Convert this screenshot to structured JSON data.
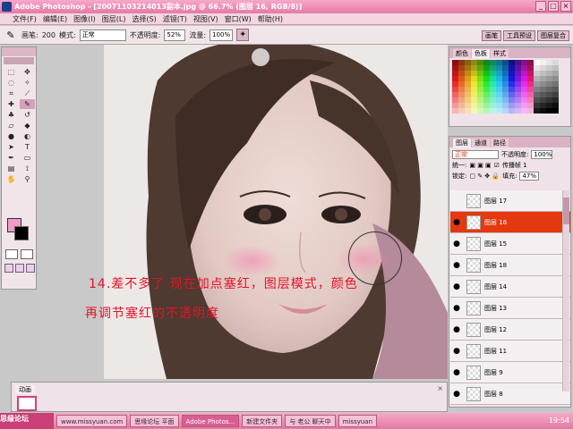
{
  "window": {
    "title": "Adobe Photoshop - [20071103214013副本.jpg @ 66.7% (图层 16, RGB/8)]"
  },
  "menu": [
    "文件(F)",
    "编辑(E)",
    "图像(I)",
    "图层(L)",
    "选择(S)",
    "滤镜(T)",
    "视图(V)",
    "窗口(W)",
    "帮助(H)"
  ],
  "options": {
    "brush_label": "画笔:",
    "brush_size": "200",
    "mode_label": "模式:",
    "mode_value": "正常",
    "opacity_label": "不透明度:",
    "opacity_value": "52%",
    "flow_label": "流量:",
    "flow_value": "100%"
  },
  "palette_well": [
    "画笔",
    "工具预设",
    "图层复合"
  ],
  "overlay": {
    "line1": "14.差不多了 现在加点塞红，图层模式，颜色",
    "line2": "再调节塞红的不透明度"
  },
  "swatches_panel": {
    "tabs": [
      "颜色",
      "色板",
      "样式"
    ],
    "active_tab": "色板"
  },
  "layers_panel": {
    "tabs": [
      "图层",
      "通道",
      "路径"
    ],
    "active_tab": "图层",
    "blend_mode": "正常",
    "opacity_label": "不透明度:",
    "opacity_value": "100%",
    "unify_label": "统一:",
    "propagate_label": "传播帧 1",
    "lock_label": "锁定:",
    "fill_label": "填充:",
    "fill_value": "47%",
    "layers": [
      {
        "name": "图层 17",
        "visible": false,
        "active": false
      },
      {
        "name": "图层 16",
        "visible": true,
        "active": true
      },
      {
        "name": "图层 15",
        "visible": true,
        "active": false
      },
      {
        "name": "图层 18",
        "visible": true,
        "active": false
      },
      {
        "name": "图层 14",
        "visible": true,
        "active": false
      },
      {
        "name": "图层 13",
        "visible": true,
        "active": false
      },
      {
        "name": "图层 12",
        "visible": true,
        "active": false
      },
      {
        "name": "图层 11",
        "visible": true,
        "active": false
      },
      {
        "name": "图层 9",
        "visible": true,
        "active": false
      },
      {
        "name": "图层 8",
        "visible": true,
        "active": false
      }
    ]
  },
  "animation_panel": {
    "tab": "动画"
  },
  "taskbar": {
    "items": [
      "思缘论坛 平面",
      "Adobe Photos...",
      "新建文件夹",
      "与 老公 聊天中",
      "missyuan"
    ],
    "active_index": 1,
    "clock": "19:54",
    "watermark": "思缘论坛",
    "site": "www.missyuan.com"
  },
  "colors": {
    "accent": "#e37aa6",
    "active_layer": "#e4380e",
    "overlay_text": "#e3132a"
  }
}
